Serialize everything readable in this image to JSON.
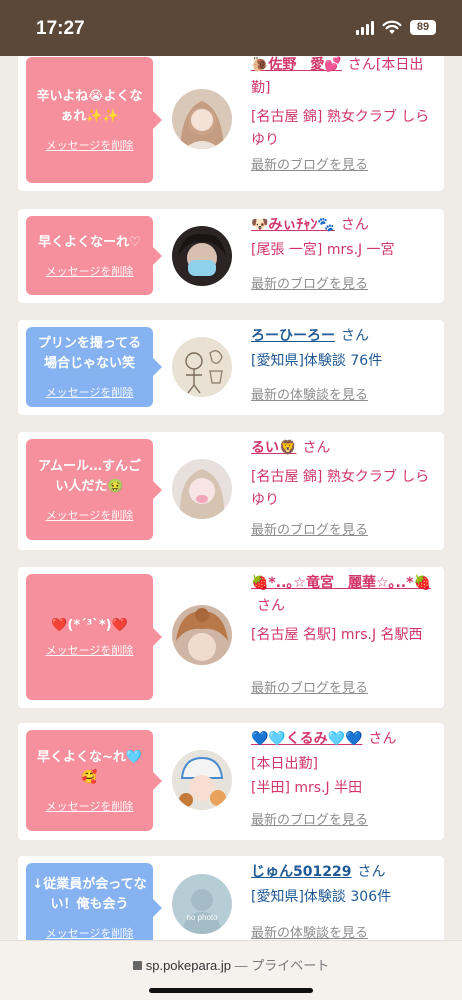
{
  "status_bar": {
    "time": "17:27",
    "battery": "89"
  },
  "cards": [
    {
      "bubble_color": "pink",
      "message": "辛いよね😭よくなぁれ✨✨",
      "delete_label": "メッセージを削除",
      "name": "🐌佐野　愛💕",
      "name_color": "pink",
      "suffix": "さん[本日出勤]",
      "shop": "[名古屋 錦] 熟女クラブ しらゆり",
      "link": "最新のブログを見る",
      "avatar": "photo-woman"
    },
    {
      "bubble_color": "pink",
      "message": "早くよくなーれ♡",
      "delete_label": "メッセージを削除",
      "name": "🐶みぃﾁｬﾝ🐾",
      "name_color": "pink",
      "suffix": "さん",
      "shop": "[尾張 一宮] mrs.J 一宮",
      "link": "最新のブログを見る",
      "avatar": "photo-masked"
    },
    {
      "bubble_color": "blue",
      "message": "プリンを撮ってる場合じゃない笑",
      "delete_label": "メッセージを削除",
      "name": "ろーひーろー",
      "name_color": "blue",
      "suffix": "さん",
      "shop": "[愛知県]体験談 76件",
      "link": "最新の体験談を見る",
      "avatar": "drawing"
    },
    {
      "bubble_color": "pink",
      "message": "アムール…すんごい人だた🤢",
      "delete_label": "メッセージを削除",
      "name": "るい🦁",
      "name_color": "pink",
      "suffix": "さん",
      "shop": "[名古屋 錦] 熟女クラブ しらゆり",
      "link": "最新のブログを見る",
      "avatar": "photo-blonde"
    },
    {
      "bubble_color": "pink",
      "message": "❤️(*´³`*)❤️",
      "delete_label": "メッセージを削除",
      "name": "🍓*..｡☆竜宮　麗華☆｡..*🍓",
      "name_color": "pink",
      "suffix": "さん",
      "shop": "[名古屋 名駅] mrs.J 名駅西",
      "link": "最新のブログを見る",
      "avatar": "photo-hair"
    },
    {
      "bubble_color": "pink",
      "message": "早くよくな~れ🩵🥰",
      "delete_label": "メッセージを削除",
      "name": "💙🩵くるみ🩵💙",
      "name_color": "pink",
      "suffix": "さん",
      "shop_lines": [
        "[本日出勤]",
        "[半田] mrs.J 半田"
      ],
      "link": "最新のブログを見る",
      "avatar": "photo-hat"
    },
    {
      "bubble_color": "blue",
      "message": "↓従業員が会ってない！俺も会う",
      "delete_label": "メッセージを削除",
      "name": "じゅん501229",
      "name_color": "blue",
      "suffix": "さん",
      "shop": "[愛知県]体験談 306件",
      "link": "最新の体験談を見る",
      "avatar": "no-photo",
      "avatar_text": "no photo"
    }
  ],
  "browser_bar": {
    "url": "sp.pokepara.jp",
    "mode": "— プライベート"
  }
}
